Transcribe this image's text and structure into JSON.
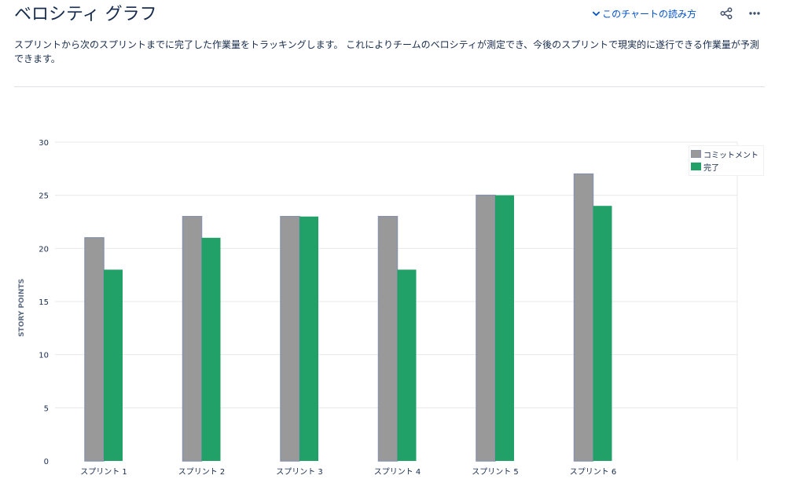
{
  "header": {
    "title": "ベロシティ グラフ",
    "help_link": "このチャートの読み方",
    "share_icon": "share-icon",
    "more_icon": "more-icon"
  },
  "description": "スプリントから次のスプリントまでに完了した作業量をトラッキングします。 これによりチームのベロシティが測定でき、今後のスプリントで現実的に遂行できる作業量が予測できます。",
  "colors": {
    "commitment": "#999999",
    "completed": "#21a068",
    "link": "#0052cc"
  },
  "chart_data": {
    "type": "bar",
    "categories": [
      "スプリント 1",
      "スプリント 2",
      "スプリント 3",
      "スプリント 4",
      "スプリント 5",
      "スプリント 6"
    ],
    "series": [
      {
        "name": "コミットメント",
        "values": [
          21,
          23,
          23,
          23,
          25,
          27
        ]
      },
      {
        "name": "完了",
        "values": [
          18,
          21,
          23,
          18,
          25,
          24
        ]
      }
    ],
    "ylabel": "STORY POINTS",
    "xlabel": "",
    "ylim": [
      0,
      30
    ],
    "yticks": [
      0,
      5,
      10,
      15,
      20,
      25,
      30
    ],
    "grid": true,
    "legend": "top-right"
  }
}
